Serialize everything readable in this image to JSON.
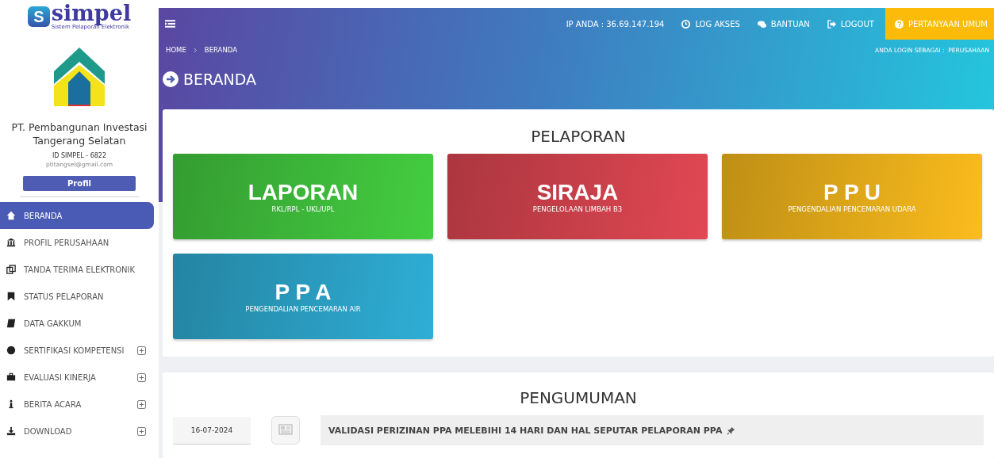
{
  "sidebar": {
    "logo": {
      "mark": "S",
      "name": "simpel",
      "tagline": "Sistem Pelaporan Elektronik"
    },
    "company": "PT. Pembangunan Investasi Tangerang Selatan",
    "id": "ID SIMPEL - 6822",
    "email": "ptitangsel@gmail.com",
    "profile_button": "Profil",
    "items": [
      {
        "label": "BERANDA",
        "kind": "home",
        "selected": true,
        "expandable": false
      },
      {
        "label": "PROFIL PERUSAHAAN",
        "kind": "bank",
        "selected": false,
        "expandable": false
      },
      {
        "label": "TANDA TERIMA ELEKTRONIK",
        "kind": "copy",
        "selected": false,
        "expandable": false
      },
      {
        "label": "STATUS PELAPORAN",
        "kind": "bookmark",
        "selected": false,
        "expandable": false
      },
      {
        "label": "DATA GAKKUM",
        "kind": "book",
        "selected": false,
        "expandable": false
      },
      {
        "label": "SERTIFIKASI KOMPETENSI",
        "kind": "badge",
        "selected": false,
        "expandable": true
      },
      {
        "label": "EVALUASI KINERJA",
        "kind": "briefcase",
        "selected": false,
        "expandable": true
      },
      {
        "label": "BERITA ACARA",
        "kind": "info",
        "selected": false,
        "expandable": true
      },
      {
        "label": "DOWNLOAD",
        "kind": "download",
        "selected": false,
        "expandable": true
      }
    ]
  },
  "topbar": {
    "ip": "IP ANDA : 36.69.147.194",
    "links": [
      {
        "label": "LOG AKSES",
        "kind": "clock"
      },
      {
        "label": "BANTUAN",
        "kind": "chat"
      },
      {
        "label": "LOGOUT",
        "kind": "logout"
      }
    ],
    "highlight": "PERTANYAAN UMUM"
  },
  "breadcrumb": [
    "HOME",
    "BERANDA"
  ],
  "login_as": "ANDA LOGIN SEBAGAI :  PERUSAHAAN",
  "page_title": "BERANDA",
  "pelaporan": {
    "title": "PELAPORAN",
    "cards": [
      {
        "title": "LAPORAN",
        "subtitle": "RKL/RPL - UKL/UPL",
        "color": "#3db83a"
      },
      {
        "title": "SIRAJA",
        "subtitle": "PENGELOLAAN LIMBAH B3",
        "color": "#c9404a"
      },
      {
        "title": "P P U",
        "subtitle": "PENGENDALIAN PENCEMARAN UDARA",
        "color": "#e0a81a"
      },
      {
        "title": "P P A",
        "subtitle": "PENGENDALIAN PENCEMARAN AIR",
        "color": "#2a9bbf"
      }
    ]
  },
  "pengumuman": {
    "title": "PENGUMUMAN",
    "items": [
      {
        "date": "16-07-2024",
        "title": "VALIDASI PERIZINAN PPA MELEBIHI 14 HARI DAN HAL SEPUTAR PELAPORAN PPA",
        "pinned": true
      }
    ]
  }
}
